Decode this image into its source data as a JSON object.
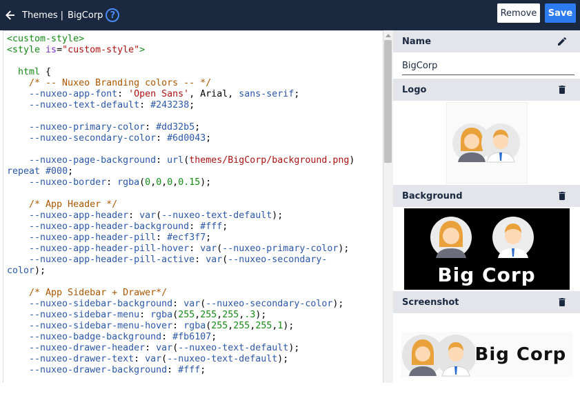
{
  "header": {
    "breadcrumb_parent": "Themes",
    "breadcrumb_separator": "|",
    "breadcrumb_current": "BigCorp",
    "help_icon": "?",
    "remove_label": "Remove",
    "save_label": "Save"
  },
  "editor": {
    "lines": [
      [
        {
          "t": "<custom-style>",
          "c": "tag"
        }
      ],
      [
        {
          "t": "<style ",
          "c": "tag"
        },
        {
          "t": "is",
          "c": "attr"
        },
        {
          "t": "=",
          "c": ""
        },
        {
          "t": "\"custom-style\"",
          "c": "str"
        },
        {
          "t": ">",
          "c": "tag"
        }
      ],
      [],
      [
        {
          "t": "  html ",
          "c": "kw"
        },
        {
          "t": "{",
          "c": ""
        }
      ],
      [
        {
          "t": "    /* -- Nuxeo Branding colors -- */",
          "c": "com"
        }
      ],
      [
        {
          "t": "    --nuxeo-app-font",
          "c": "prop"
        },
        {
          "t": ": ",
          "c": ""
        },
        {
          "t": "'Open Sans'",
          "c": "str"
        },
        {
          "t": ", Arial, ",
          "c": ""
        },
        {
          "t": "sans-serif",
          "c": "val"
        },
        {
          "t": ";",
          "c": ""
        }
      ],
      [
        {
          "t": "    --nuxeo-text-default",
          "c": "prop"
        },
        {
          "t": ": ",
          "c": ""
        },
        {
          "t": "#243238",
          "c": "val"
        },
        {
          "t": ";",
          "c": ""
        }
      ],
      [],
      [
        {
          "t": "    --nuxeo-primary-color",
          "c": "prop"
        },
        {
          "t": ": ",
          "c": ""
        },
        {
          "t": "#dd32b5",
          "c": "val"
        },
        {
          "t": ";",
          "c": ""
        }
      ],
      [
        {
          "t": "    --nuxeo-secondary-color",
          "c": "prop"
        },
        {
          "t": ": ",
          "c": ""
        },
        {
          "t": "#6d0043",
          "c": "val"
        },
        {
          "t": ";",
          "c": ""
        }
      ],
      [],
      [
        {
          "t": "    --nuxeo-page-background",
          "c": "prop"
        },
        {
          "t": ": ",
          "c": ""
        },
        {
          "t": "url",
          "c": "fn"
        },
        {
          "t": "(",
          "c": ""
        },
        {
          "t": "themes/BigCorp/background.png",
          "c": "str"
        },
        {
          "t": ")",
          "c": ""
        }
      ],
      [
        {
          "t": "repeat ",
          "c": "val"
        },
        {
          "t": "#000",
          "c": "val"
        },
        {
          "t": ";",
          "c": ""
        }
      ],
      [
        {
          "t": "    --nuxeo-border",
          "c": "prop"
        },
        {
          "t": ": ",
          "c": ""
        },
        {
          "t": "rgba",
          "c": "fn"
        },
        {
          "t": "(",
          "c": ""
        },
        {
          "t": "0",
          "c": "num"
        },
        {
          "t": ",",
          "c": ""
        },
        {
          "t": "0",
          "c": "num"
        },
        {
          "t": ",",
          "c": ""
        },
        {
          "t": "0",
          "c": "num"
        },
        {
          "t": ",",
          "c": ""
        },
        {
          "t": "0.15",
          "c": "num"
        },
        {
          "t": ");",
          "c": ""
        }
      ],
      [],
      [
        {
          "t": "    /* App Header */",
          "c": "com"
        }
      ],
      [
        {
          "t": "    --nuxeo-app-header",
          "c": "prop"
        },
        {
          "t": ": ",
          "c": ""
        },
        {
          "t": "var",
          "c": "fn"
        },
        {
          "t": "(",
          "c": ""
        },
        {
          "t": "--nuxeo-text-default",
          "c": "prop"
        },
        {
          "t": ");",
          "c": ""
        }
      ],
      [
        {
          "t": "    --nuxeo-app-header-background",
          "c": "prop"
        },
        {
          "t": ": ",
          "c": ""
        },
        {
          "t": "#fff",
          "c": "val"
        },
        {
          "t": ";",
          "c": ""
        }
      ],
      [
        {
          "t": "    --nuxeo-app-header-pill",
          "c": "prop"
        },
        {
          "t": ": ",
          "c": ""
        },
        {
          "t": "#ecf3f7",
          "c": "val"
        },
        {
          "t": ";",
          "c": ""
        }
      ],
      [
        {
          "t": "    --nuxeo-app-header-pill-hover",
          "c": "prop"
        },
        {
          "t": ": ",
          "c": ""
        },
        {
          "t": "var",
          "c": "fn"
        },
        {
          "t": "(",
          "c": ""
        },
        {
          "t": "--nuxeo-primary-color",
          "c": "prop"
        },
        {
          "t": ");",
          "c": ""
        }
      ],
      [
        {
          "t": "    --nuxeo-app-header-pill-active",
          "c": "prop"
        },
        {
          "t": ": ",
          "c": ""
        },
        {
          "t": "var",
          "c": "fn"
        },
        {
          "t": "(",
          "c": ""
        },
        {
          "t": "--nuxeo-secondary-",
          "c": "prop"
        }
      ],
      [
        {
          "t": "color",
          "c": "prop"
        },
        {
          "t": ");",
          "c": ""
        }
      ],
      [],
      [
        {
          "t": "    /* App Sidebar + Drawer*/",
          "c": "com"
        }
      ],
      [
        {
          "t": "    --nuxeo-sidebar-background",
          "c": "prop"
        },
        {
          "t": ": ",
          "c": ""
        },
        {
          "t": "var",
          "c": "fn"
        },
        {
          "t": "(",
          "c": ""
        },
        {
          "t": "--nuxeo-secondary-color",
          "c": "prop"
        },
        {
          "t": ");",
          "c": ""
        }
      ],
      [
        {
          "t": "    --nuxeo-sidebar-menu",
          "c": "prop"
        },
        {
          "t": ": ",
          "c": ""
        },
        {
          "t": "rgba",
          "c": "fn"
        },
        {
          "t": "(",
          "c": ""
        },
        {
          "t": "255",
          "c": "num"
        },
        {
          "t": ",",
          "c": ""
        },
        {
          "t": "255",
          "c": "num"
        },
        {
          "t": ",",
          "c": ""
        },
        {
          "t": "255",
          "c": "num"
        },
        {
          "t": ",",
          "c": ""
        },
        {
          "t": ".3",
          "c": "num"
        },
        {
          "t": ");",
          "c": ""
        }
      ],
      [
        {
          "t": "    --nuxeo-sidebar-menu-hover",
          "c": "prop"
        },
        {
          "t": ": ",
          "c": ""
        },
        {
          "t": "rgba",
          "c": "fn"
        },
        {
          "t": "(",
          "c": ""
        },
        {
          "t": "255",
          "c": "num"
        },
        {
          "t": ",",
          "c": ""
        },
        {
          "t": "255",
          "c": "num"
        },
        {
          "t": ",",
          "c": ""
        },
        {
          "t": "255",
          "c": "num"
        },
        {
          "t": ",",
          "c": ""
        },
        {
          "t": "1",
          "c": "num"
        },
        {
          "t": ");",
          "c": ""
        }
      ],
      [
        {
          "t": "    --nuxeo-badge-background",
          "c": "prop"
        },
        {
          "t": ": ",
          "c": ""
        },
        {
          "t": "#fb6107",
          "c": "val"
        },
        {
          "t": ";",
          "c": ""
        }
      ],
      [
        {
          "t": "    --nuxeo-drawer-header",
          "c": "prop"
        },
        {
          "t": ": ",
          "c": ""
        },
        {
          "t": "var",
          "c": "fn"
        },
        {
          "t": "(",
          "c": ""
        },
        {
          "t": "--nuxeo-text-default",
          "c": "prop"
        },
        {
          "t": ");",
          "c": ""
        }
      ],
      [
        {
          "t": "    --nuxeo-drawer-text",
          "c": "prop"
        },
        {
          "t": ": ",
          "c": ""
        },
        {
          "t": "var",
          "c": "fn"
        },
        {
          "t": "(",
          "c": ""
        },
        {
          "t": "--nuxeo-text-default",
          "c": "prop"
        },
        {
          "t": ");",
          "c": ""
        }
      ],
      [
        {
          "t": "    --nuxeo-drawer-background",
          "c": "prop"
        },
        {
          "t": ": ",
          "c": ""
        },
        {
          "t": "#fff",
          "c": "val"
        },
        {
          "t": ";",
          "c": ""
        }
      ]
    ]
  },
  "panel": {
    "name_title": "Name",
    "name_value": "BigCorp",
    "logo_title": "Logo",
    "background_title": "Background",
    "background_text": "Big Corp",
    "screenshot_title": "Screenshot",
    "screenshot_text": "Big Corp"
  },
  "colors": {
    "header_bg": "#1b2940",
    "accent": "#2d7bf0",
    "section_bg": "#e3e5ea"
  },
  "icons": {
    "back": "arrow-left-icon",
    "help": "help-circle-icon",
    "edit": "pencil-icon",
    "delete": "trash-icon"
  }
}
